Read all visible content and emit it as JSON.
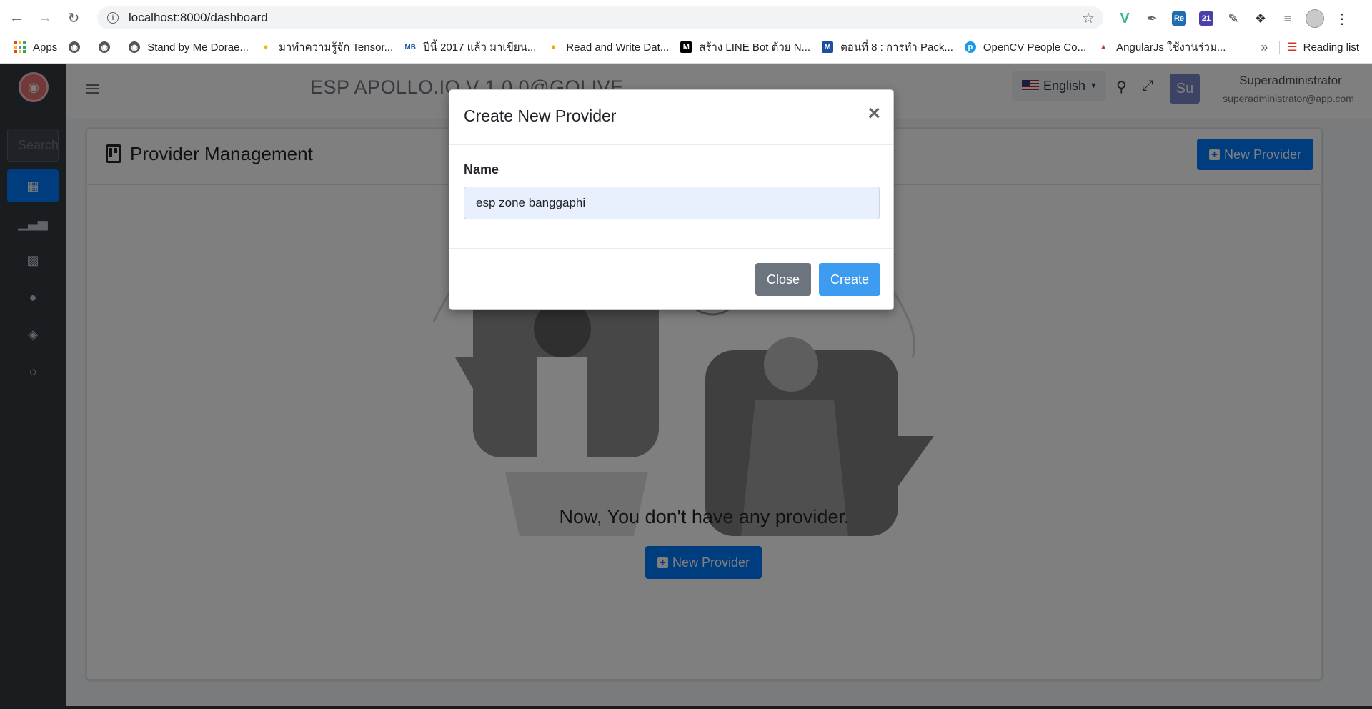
{
  "browser": {
    "url": "localhost:8000/dashboard",
    "bookmarks": [
      {
        "label": "Apps",
        "icon": "apps-grid-icon"
      },
      {
        "label": "",
        "icon": "globe-icon"
      },
      {
        "label": "",
        "icon": "globe-icon"
      },
      {
        "label": "Stand by Me Dorae...",
        "icon": "globe-icon"
      },
      {
        "label": "มาทำความรู้จัก Tensor...",
        "icon": "lightbulb-icon"
      },
      {
        "label": "ปีนี้ 2017 แล้ว มาเขียน...",
        "icon": "mb-icon"
      },
      {
        "label": "Read and Write Dat...",
        "icon": "firebase-icon"
      },
      {
        "label": "สร้าง LINE Bot ด้วย N...",
        "icon": "medium-icon"
      },
      {
        "label": "ตอนที่ 8 : การทำ Pack...",
        "icon": "blog-icon"
      },
      {
        "label": "OpenCV People Co...",
        "icon": "pyimagesearch-icon"
      },
      {
        "label": "AngularJs ใช้งานร่วม...",
        "icon": "fox-icon"
      }
    ],
    "reading_list": "Reading list",
    "more": "»"
  },
  "sidebar": {
    "search_placeholder": "Search",
    "items": [
      {
        "name": "dashboard",
        "icon": "kanban-icon",
        "active": true
      },
      {
        "name": "reports",
        "icon": "chart-icon",
        "active": false
      },
      {
        "name": "terminal",
        "icon": "terminal-icon",
        "active": false
      },
      {
        "name": "users",
        "icon": "user-icon",
        "active": false
      },
      {
        "name": "layers",
        "icon": "layers-icon",
        "active": false
      },
      {
        "name": "profile",
        "icon": "user-outline-icon",
        "active": false
      }
    ]
  },
  "topbar": {
    "brand": "ESP APOLLO.IO V 1.0.0@GOLIVE",
    "language": "English",
    "avatar_initials": "Su",
    "user_name": "Superadministrator",
    "user_email": "superadministrator@app.com"
  },
  "page": {
    "title": "Provider Management",
    "new_provider_button": "New Provider",
    "empty_message": "Now, You don't have any provider.",
    "empty_new_provider_button": "New Provider"
  },
  "modal": {
    "title": "Create New Provider",
    "close_symbol": "×",
    "name_label": "Name",
    "name_value": "esp zone banggaphi",
    "close_button": "Close",
    "create_button": "Create"
  },
  "colors": {
    "primary": "#007bff",
    "sidebar": "#343a40",
    "secondary": "#6c757d",
    "autofill": "#e8f0fe"
  }
}
